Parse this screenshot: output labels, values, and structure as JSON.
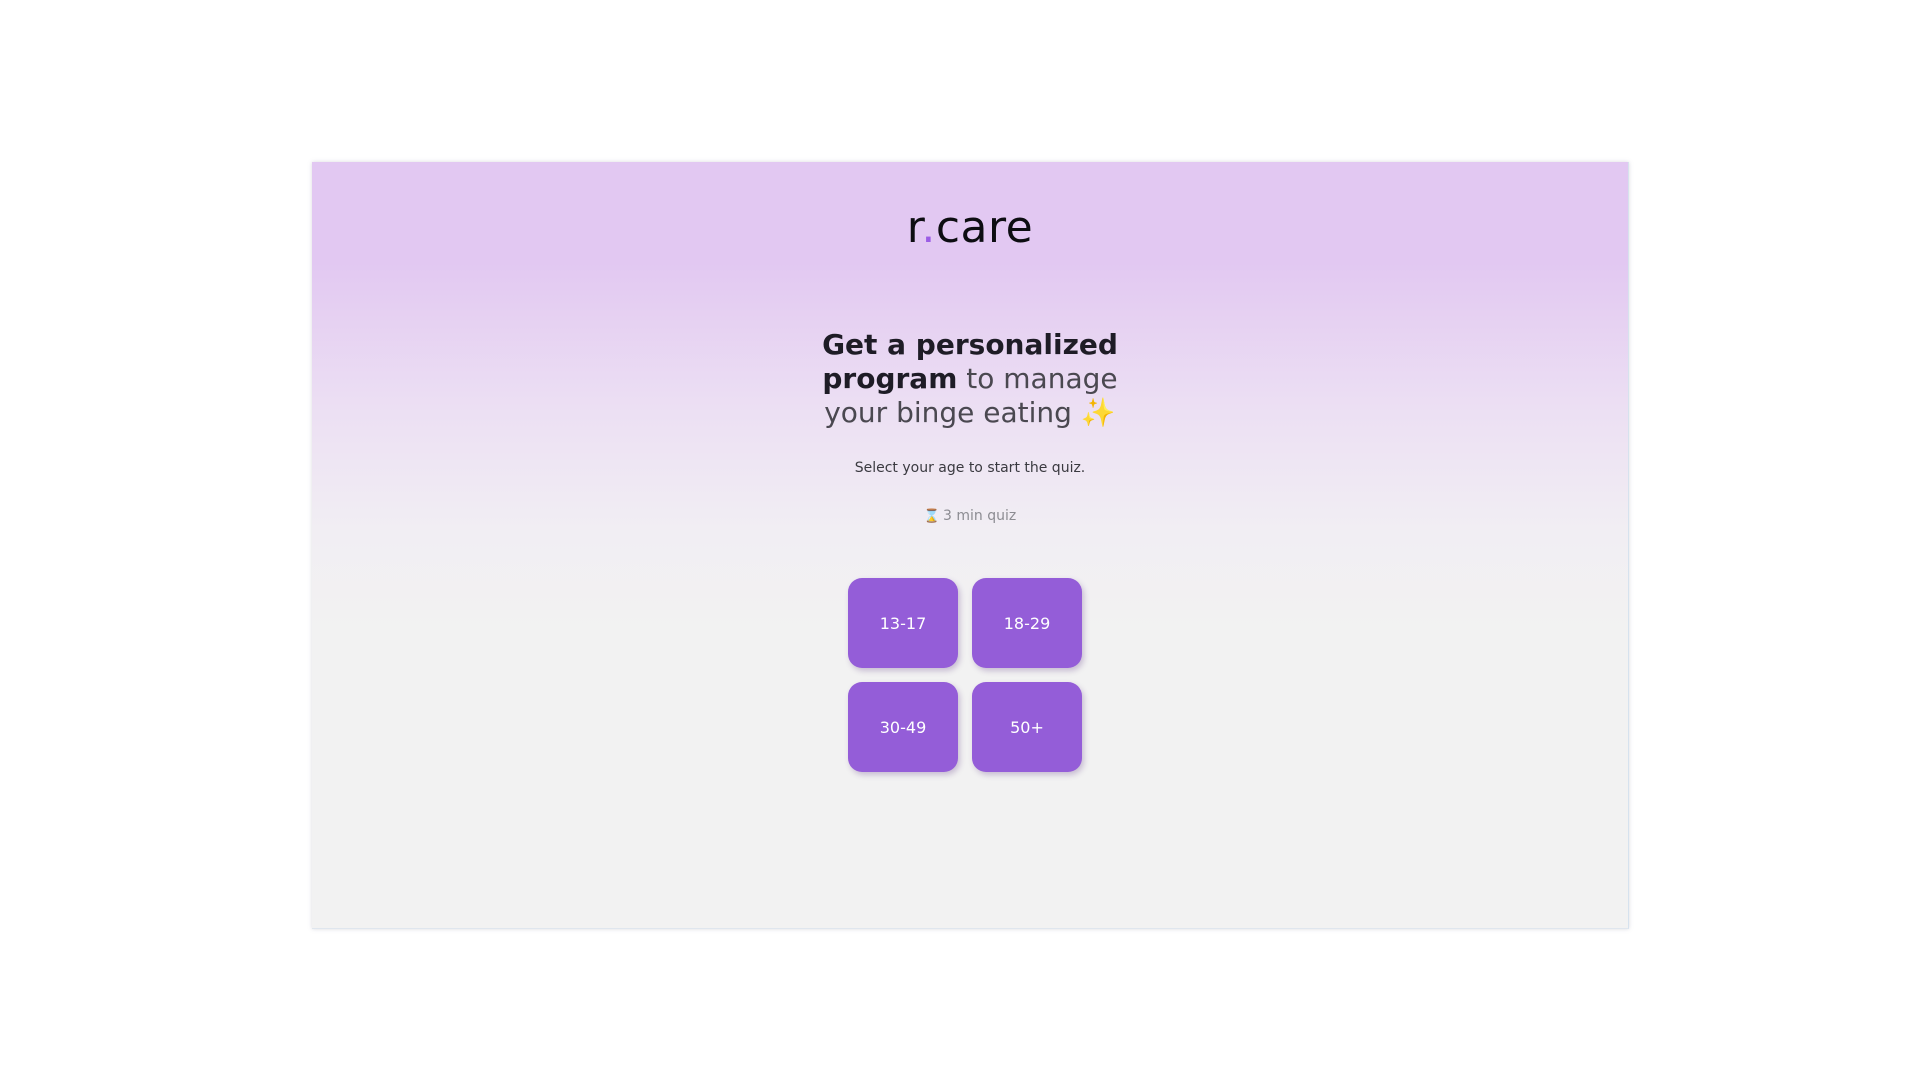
{
  "brand": {
    "logo_prefix": "r",
    "logo_dot": ".",
    "logo_suffix": "care",
    "accent_color": "#9b5de5"
  },
  "hero": {
    "headline_bold_1": "Get a personalized",
    "headline_bold_2": "program",
    "headline_light_2": " to manage",
    "headline_light_3": "your binge eating",
    "headline_emoji": "✨",
    "subtitle": "Select your age to start the quiz.",
    "duration_icon": "⌛",
    "duration_text": "3 min quiz"
  },
  "age_options": [
    {
      "label": "13-17"
    },
    {
      "label": "18-29"
    },
    {
      "label": "30-49"
    },
    {
      "label": "50+"
    }
  ],
  "colors": {
    "button_bg": "#945dd8",
    "button_text": "#ffffff"
  }
}
